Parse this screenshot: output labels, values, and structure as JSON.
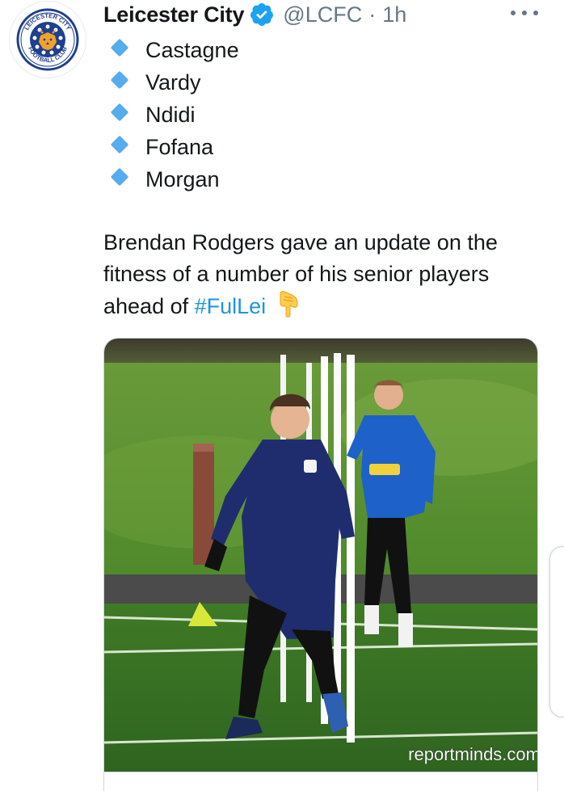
{
  "tweet": {
    "display_name": "Leicester City",
    "handle": "@LCFC",
    "separator": "·",
    "time": "1h",
    "players": [
      "Castagne",
      "Vardy",
      "Ndidi",
      "Fofana",
      "Morgan"
    ],
    "text_line1": "Brendan Rodgers gave an update on the",
    "text_line2": "fitness of a number of his senior players",
    "text_line3_prefix": "ahead of ",
    "hashtag": "#FulLei",
    "media_watermark": "reportminds.com"
  },
  "icons": {
    "list_bullet": "blue-diamond-icon",
    "verified": "verified-badge-icon",
    "more": "more-dots-icon",
    "pointing": "backhand-index-pointing-down-icon"
  },
  "colors": {
    "accent": "#1b95e0",
    "verified": "#1da1f2",
    "bullet": "#55acee",
    "text": "#14171a",
    "muted": "#657786"
  },
  "avatar_logo": {
    "text_top": "LEICESTER CITY",
    "text_bottom": "FOOTBALL CLUB"
  }
}
